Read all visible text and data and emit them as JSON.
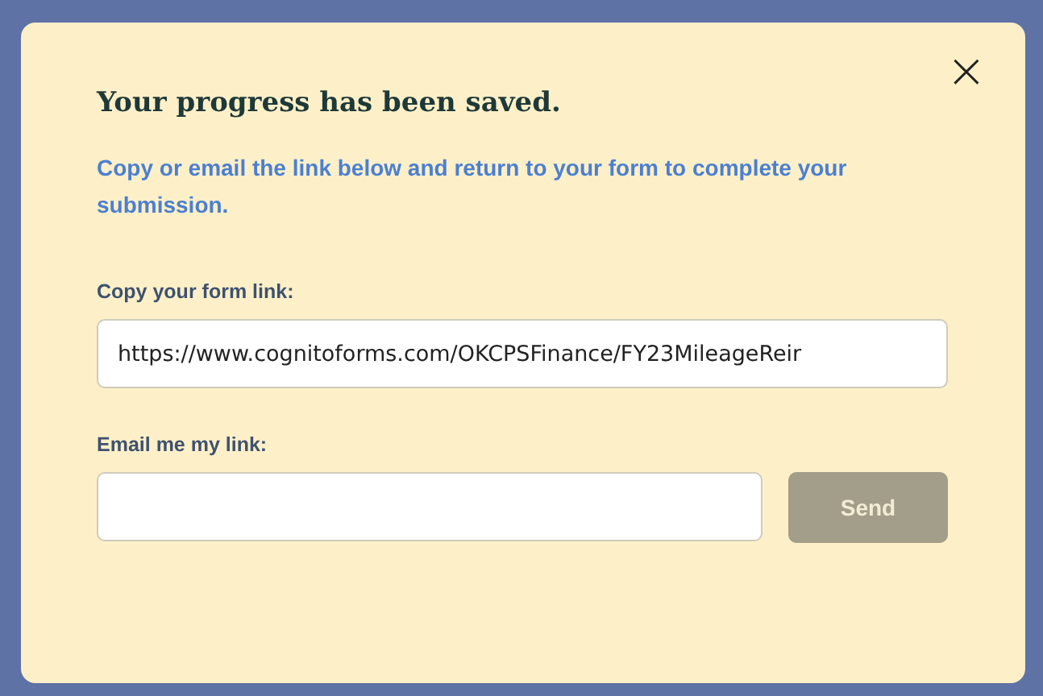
{
  "dialog": {
    "title": "Your progress has been saved.",
    "close": "×",
    "message": "Copy or email the link below and return to your form to complete your submission.",
    "link_label": "Copy your form link:",
    "link_value": "https://www.cognitoforms.com/OKCPSFinance/FY23MileageReir",
    "email_label": "Email me my link:",
    "send_button": {
      "label": "Send",
      "disabled": true
    }
  }
}
